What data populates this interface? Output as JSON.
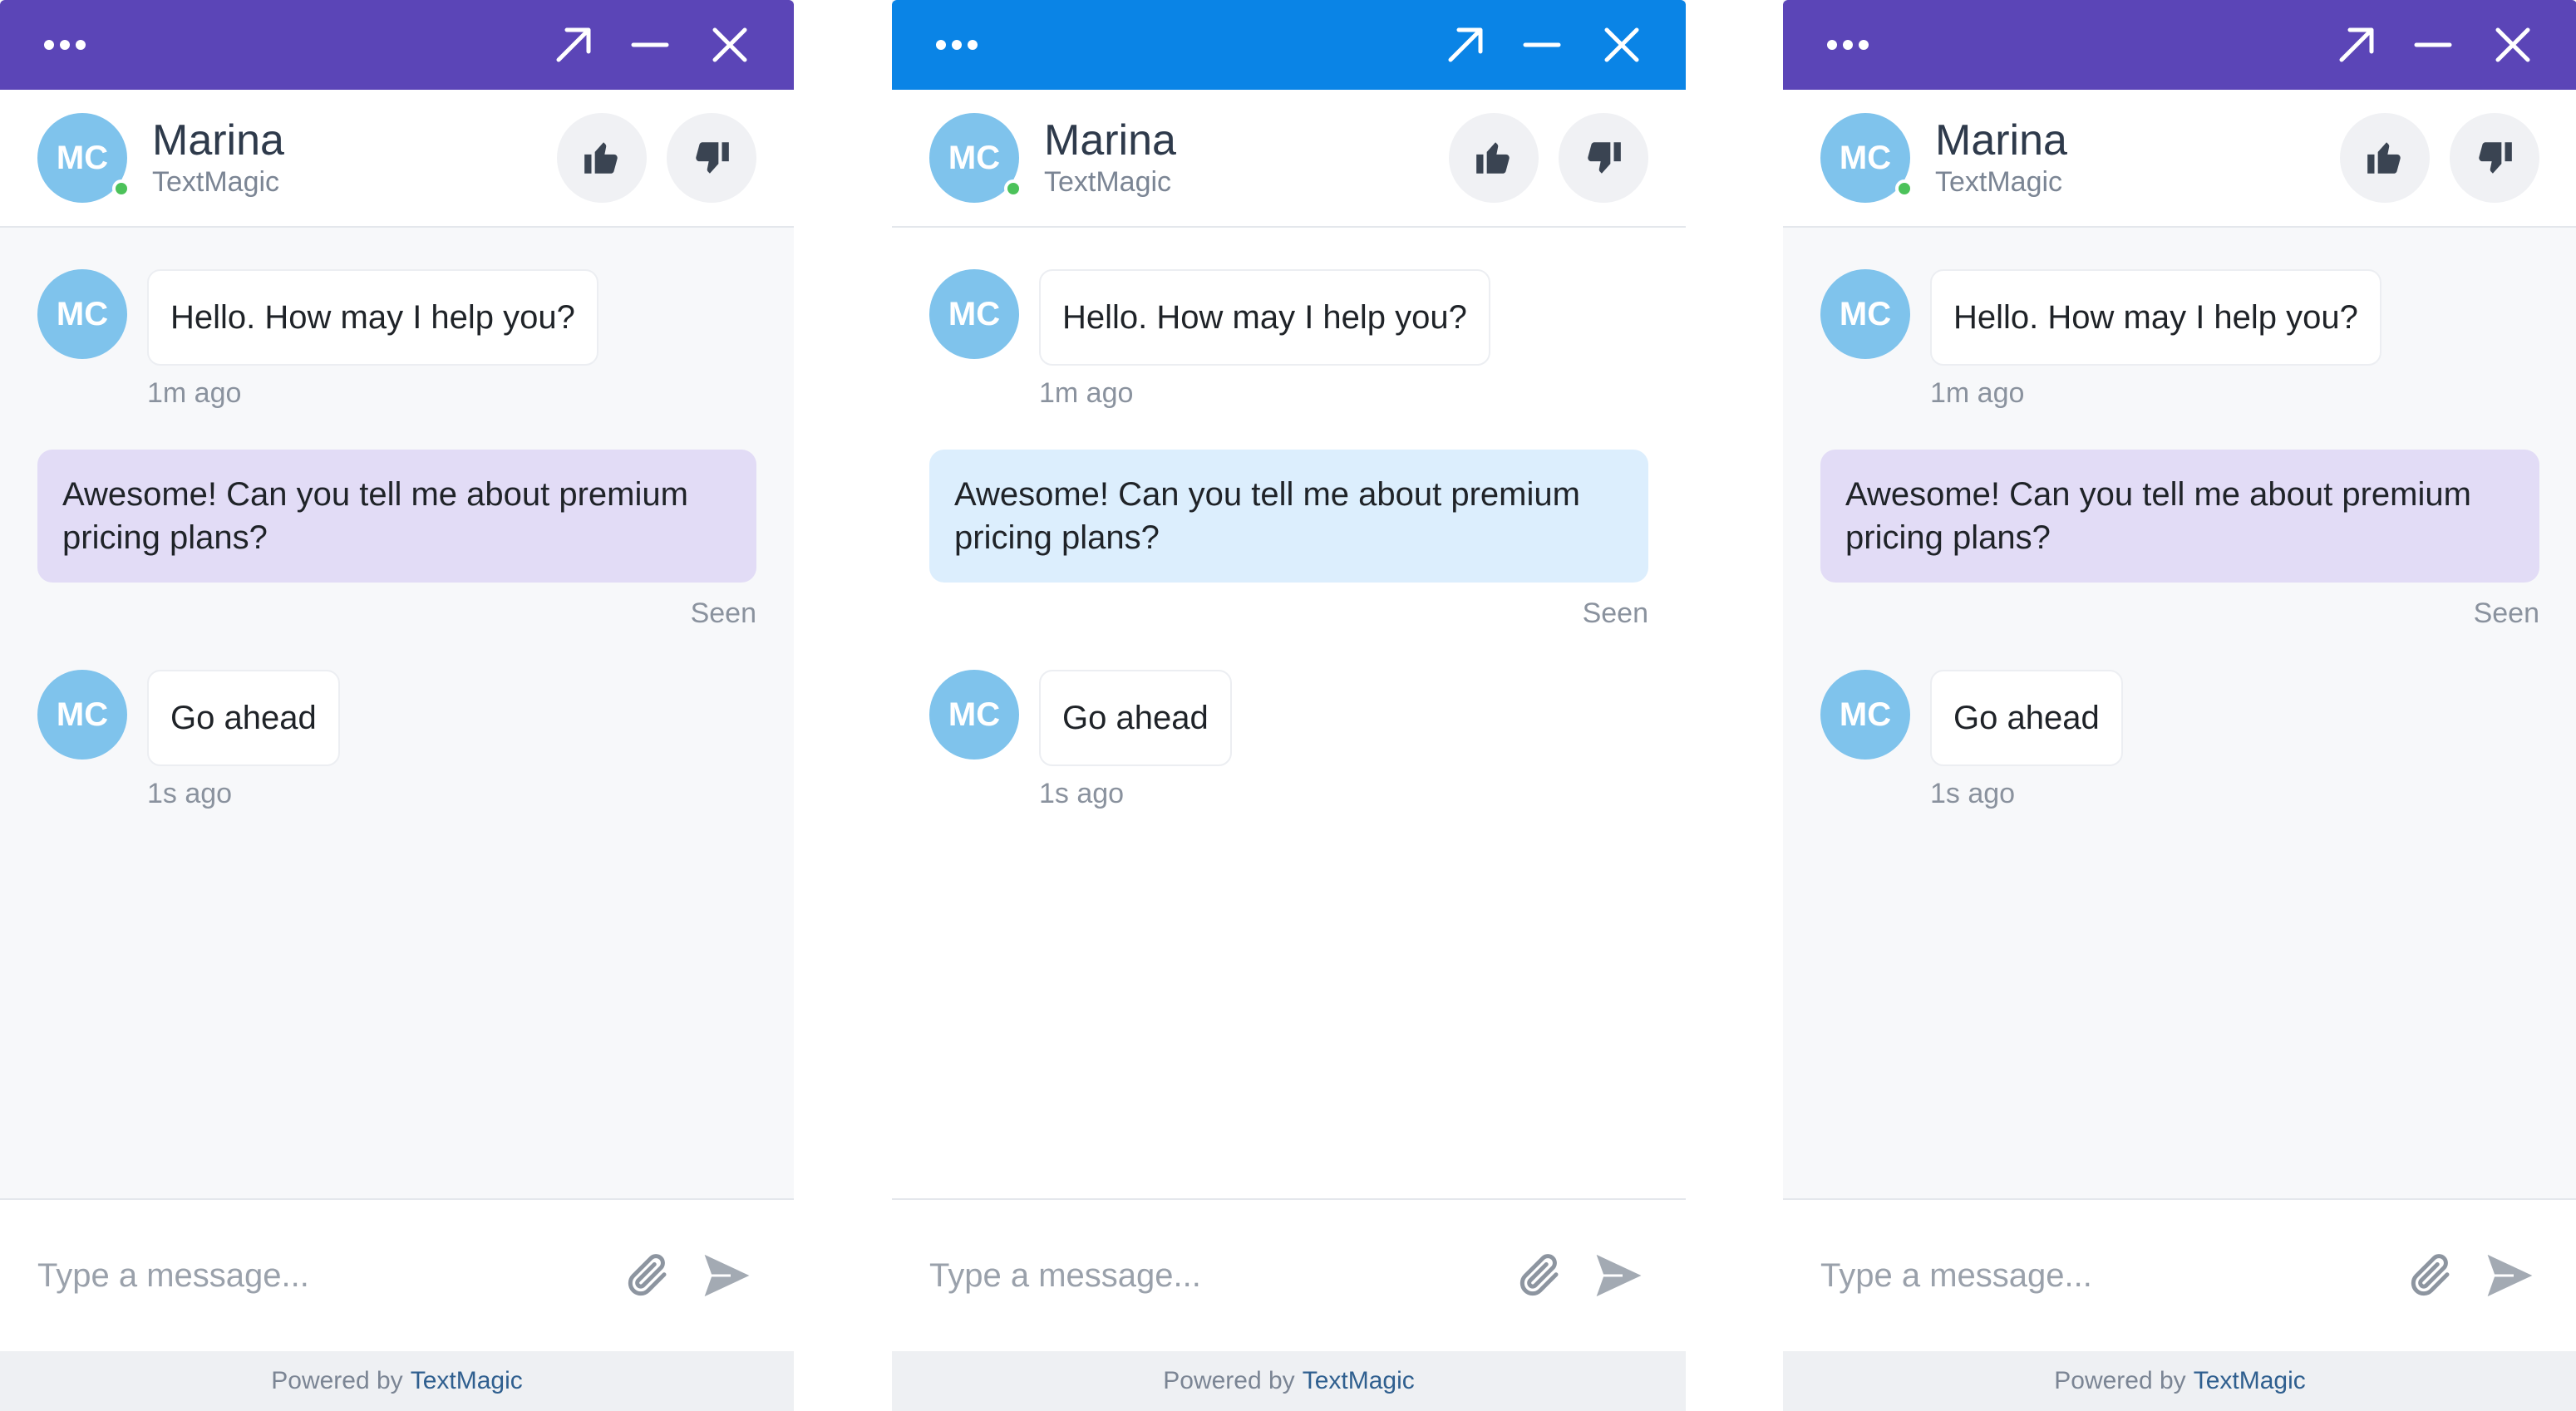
{
  "colors": {
    "purple_header": "#5b45b7",
    "blue_header": "#0a84e6",
    "purple_bubble": "#e2dcf6",
    "blue_bubble": "#dceefd",
    "avatar_bg": "#7fc3ec",
    "online": "#4cc25a"
  },
  "icons": [
    "more-dots-icon",
    "expand-icon",
    "minimize-icon",
    "close-icon",
    "thumbs-up-icon",
    "thumbs-down-icon",
    "paperclip-icon",
    "send-icon"
  ],
  "widgets": [
    {
      "theme": "purple",
      "agent": {
        "initials": "MC",
        "name": "Marina",
        "company": "TextMagic"
      },
      "messages": {
        "m1": {
          "text": "Hello. How may I help you?",
          "time": "1m ago"
        },
        "m2": {
          "text": "Awesome! Can you tell me about premium pricing plans?",
          "status": "Seen"
        },
        "m3": {
          "text": "Go ahead",
          "time": "1s ago"
        }
      },
      "input_placeholder": "Type a message...",
      "footer": {
        "prefix": "Powered by",
        "brand": "TextMagic"
      }
    },
    {
      "theme": "blue",
      "agent": {
        "initials": "MC",
        "name": "Marina",
        "company": "TextMagic"
      },
      "messages": {
        "m1": {
          "text": "Hello. How may I help you?",
          "time": "1m ago"
        },
        "m2": {
          "text": "Awesome! Can you tell me about premium pricing plans?",
          "status": "Seen"
        },
        "m3": {
          "text": "Go ahead",
          "time": "1s ago"
        }
      },
      "input_placeholder": "Type a message...",
      "footer": {
        "prefix": "Powered by",
        "brand": "TextMagic"
      }
    },
    {
      "theme": "purple",
      "agent": {
        "initials": "MC",
        "name": "Marina",
        "company": "TextMagic"
      },
      "messages": {
        "m1": {
          "text": "Hello. How may I help you?",
          "time": "1m ago"
        },
        "m2": {
          "text": "Awesome! Can you tell me about premium pricing plans?",
          "status": "Seen"
        },
        "m3": {
          "text": "Go ahead",
          "time": "1s ago"
        }
      },
      "input_placeholder": "Type a message...",
      "footer": {
        "prefix": "Powered by",
        "brand": "TextMagic"
      }
    }
  ]
}
